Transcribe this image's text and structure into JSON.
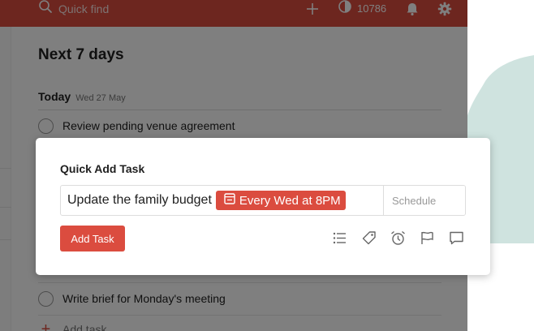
{
  "topbar": {
    "search_placeholder": "Quick find",
    "karma_value": "10786",
    "icons": [
      "search-icon",
      "add-icon",
      "karma-icon",
      "bell-icon",
      "gear-icon"
    ]
  },
  "main": {
    "page_title": "Next 7 days",
    "section": {
      "title": "Today",
      "date": "Wed 27 May"
    },
    "tasks": [
      {
        "label": "Review pending venue agreement"
      },
      {
        "label": "Write brief for Monday's meeting"
      }
    ],
    "add_task_label": "Add task"
  },
  "quick_add": {
    "title": "Quick Add Task",
    "input_text": "Update the family budget",
    "date_chip": "Every Wed at 8PM",
    "schedule_placeholder": "Schedule",
    "submit_label": "Add Task",
    "icons": [
      "project-list-icon",
      "label-tag-icon",
      "reminder-alarm-icon",
      "priority-flag-icon",
      "comment-icon"
    ]
  },
  "colors": {
    "accent": "#db4c3f",
    "brush": "#cfe3df"
  }
}
